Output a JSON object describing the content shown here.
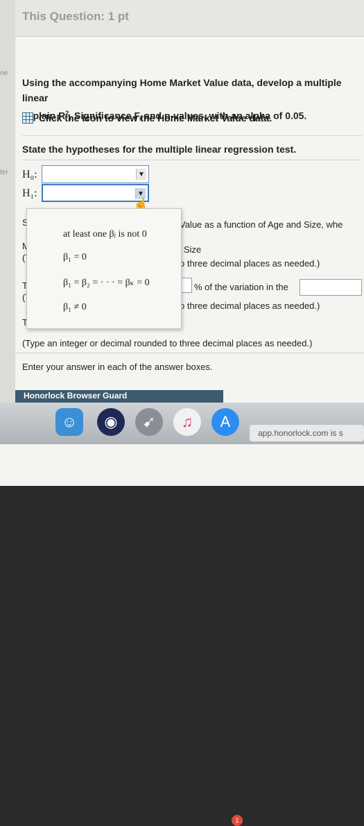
{
  "header": {
    "title": "This Question: 1 pt"
  },
  "left_tags": [
    "ne",
    "ter"
  ],
  "prompt": {
    "line1": "Using the accompanying Home Market Value data, develop a multiple linear",
    "line2_pre": "explain R",
    "line2_sup": "2",
    "line2_post": ", Significance F, and p-values, with an alpha of 0.05."
  },
  "data_link": {
    "label": "Click the icon to view the Home Market Value data."
  },
  "hypotheses": {
    "title": "State the hypotheses for the multiple linear regression test.",
    "h0_label": "H₀:",
    "h1_label": "H₁:"
  },
  "dropdown_options": [
    "at least one βⱼ is not 0",
    "β₁ = 0",
    "β₁ = β₂ = · · · = βₖ = 0",
    "β₁ ≠ 0"
  ],
  "body_rows": {
    "state": "State",
    "state_right": "Value as a function of Age and Size, whe",
    "mark": "Mark",
    "size": "Size",
    "typ1": "(Typ",
    "decimals1": "o three decimal places as needed.)",
    "the": "The",
    "variation": "% of the variation in the",
    "typ2": "(Typ",
    "decimals2": "o three decimal places as needed.)",
    "the_sig": "The",
    "type_instr": "(Type an integer or decimal rounded to three decimal places as needed.)",
    "enter_instr": "Enter your answer in each of the answer boxes."
  },
  "footer": {
    "label": "Honorlock Browser Guard"
  },
  "dock": {
    "badge": "1",
    "status_text": "app.honorlock.com is s"
  }
}
